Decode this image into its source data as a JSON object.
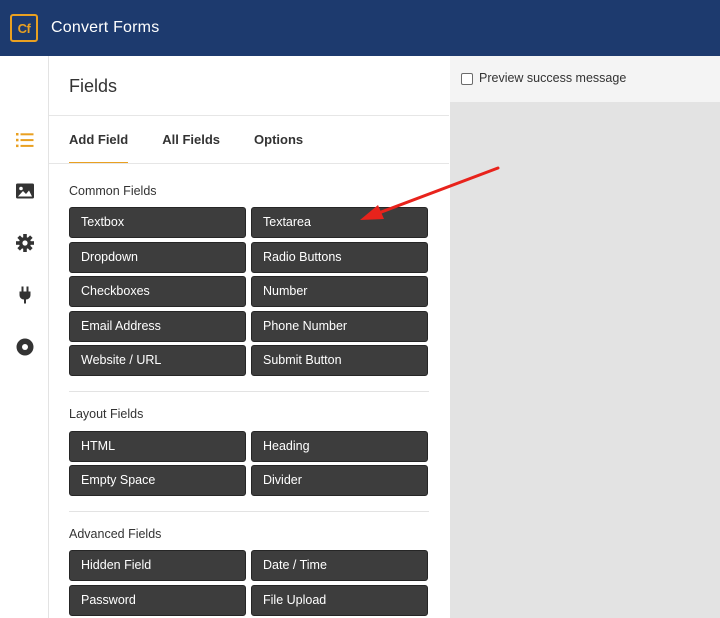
{
  "app": {
    "logo_text": "Cf",
    "title": "Convert Forms",
    "brand_color": "#1d3a6e",
    "accent_color": "#e9a021"
  },
  "sidebar": {
    "icons": [
      "fields-list-icon",
      "image-icon",
      "gear-icon",
      "plug-icon",
      "circle-dot-icon"
    ],
    "active_icon": "fields-list-icon"
  },
  "panel": {
    "title": "Fields",
    "tabs": [
      {
        "label": "Add Field",
        "active": true
      },
      {
        "label": "All Fields",
        "active": false
      },
      {
        "label": "Options",
        "active": false
      }
    ],
    "sections": [
      {
        "title": "Common Fields",
        "buttons": [
          "Textbox",
          "Textarea",
          "Dropdown",
          "Radio Buttons",
          "Checkboxes",
          "Number",
          "Email Address",
          "Phone Number",
          "Website / URL",
          "Submit Button"
        ]
      },
      {
        "title": "Layout Fields",
        "buttons": [
          "HTML",
          "Heading",
          "Empty Space",
          "Divider"
        ]
      },
      {
        "title": "Advanced Fields",
        "buttons": [
          "Hidden Field",
          "Date / Time",
          "Password",
          "File Upload"
        ]
      }
    ]
  },
  "preview": {
    "checkbox_label": "Preview success message",
    "checked": false
  },
  "annotation": {
    "arrow_color": "#e8231c",
    "points_to": "Textarea"
  }
}
